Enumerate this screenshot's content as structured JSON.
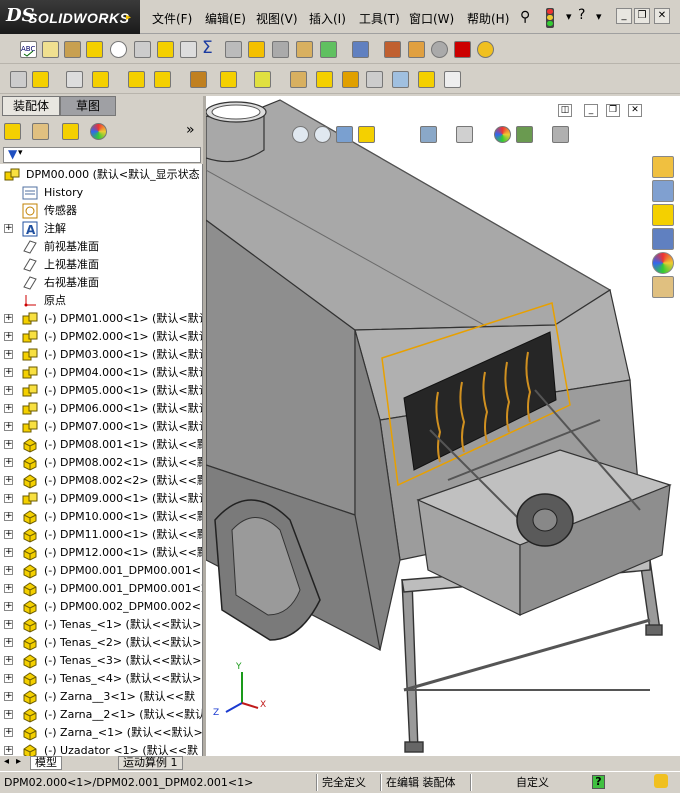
{
  "app": {
    "brand": "SOLIDWORKS",
    "brand_prefix": "DS"
  },
  "menu": [
    "文件(F)",
    "编辑(E)",
    "视图(V)",
    "插入(I)",
    "工具(T)",
    "窗口(W)",
    "帮助(H)"
  ],
  "panel_tabs": {
    "assembly": "装配体",
    "sketch": "草图"
  },
  "tree": {
    "root": "DPM00.000 (默认<默认_显示状态",
    "items": [
      {
        "label": "History",
        "type": "history",
        "expand": false
      },
      {
        "label": "传感器",
        "type": "sensor",
        "expand": false
      },
      {
        "label": "注解",
        "type": "annotation",
        "expand": true
      },
      {
        "label": "前视基准面",
        "type": "plane",
        "expand": false
      },
      {
        "label": "上视基准面",
        "type": "plane",
        "expand": false
      },
      {
        "label": "右视基准面",
        "type": "plane",
        "expand": false
      },
      {
        "label": "原点",
        "type": "origin",
        "expand": false
      },
      {
        "label": "(-) DPM01.000<1> (默认<默认",
        "type": "subasm",
        "expand": true
      },
      {
        "label": "(-) DPM02.000<1> (默认<默认",
        "type": "subasm",
        "expand": true
      },
      {
        "label": "(-) DPM03.000<1> (默认<默认",
        "type": "subasm",
        "expand": true
      },
      {
        "label": "(-) DPM04.000<1> (默认<默认",
        "type": "subasm",
        "expand": true
      },
      {
        "label": "(-) DPM05.000<1> (默认<默认",
        "type": "subasm",
        "expand": true
      },
      {
        "label": "(-) DPM06.000<1> (默认<默认",
        "type": "subasm",
        "expand": true
      },
      {
        "label": "(-) DPM07.000<1> (默认<默认",
        "type": "subasm",
        "expand": true
      },
      {
        "label": "(-) DPM08.001<1> (默认<<默",
        "type": "part",
        "expand": true
      },
      {
        "label": "(-) DPM08.002<1> (默认<<默",
        "type": "part",
        "expand": true
      },
      {
        "label": "(-) DPM08.002<2> (默认<<默",
        "type": "part",
        "expand": true
      },
      {
        "label": "(-) DPM09.000<1> (默认<默认",
        "type": "subasm",
        "expand": true
      },
      {
        "label": "(-) DPM10.000<1> (默认<<默认",
        "type": "part",
        "expand": true
      },
      {
        "label": "(-) DPM11.000<1> (默认<<默认",
        "type": "part",
        "expand": true
      },
      {
        "label": "(-) DPM12.000<1> (默认<<默认",
        "type": "part",
        "expand": true
      },
      {
        "label": "(-) DPM00.001_DPM00.001<1>",
        "type": "part",
        "expand": true
      },
      {
        "label": "(-) DPM00.001_DPM00.001<2>",
        "type": "part",
        "expand": true
      },
      {
        "label": "(-) DPM00.002_DPM00.002<1>",
        "type": "part",
        "expand": true
      },
      {
        "label": "(-) Tenas_<1> (默认<<默认>",
        "type": "part",
        "expand": true
      },
      {
        "label": "(-) Tenas_<2> (默认<<默认>",
        "type": "part",
        "expand": true
      },
      {
        "label": "(-) Tenas_<3> (默认<<默认>",
        "type": "part",
        "expand": true
      },
      {
        "label": "(-) Tenas_<4> (默认<<默认>",
        "type": "part",
        "expand": true
      },
      {
        "label": "(-) Zarna__3<1> (默认<<默",
        "type": "part",
        "expand": true
      },
      {
        "label": "(-) Zarna__2<1> (默认<<默认",
        "type": "part",
        "expand": true
      },
      {
        "label": "(-) Zarna_<1> (默认<<默认>",
        "type": "part",
        "expand": true
      },
      {
        "label": "(-) Uzadator <1> (默认<<默",
        "type": "part",
        "expand": true
      }
    ]
  },
  "bottom_tabs": [
    "模型",
    "运动算例 1"
  ],
  "status": {
    "selection": "DPM02.000<1>/DPM02.001_DPM02.001<1>",
    "constraint": "完全定义",
    "mode": "在编辑 装配体",
    "units": "自定义",
    "help": "?"
  },
  "colors": {
    "accent": "#f1c000",
    "part_yellow": "#f4d000",
    "body_gray": "#8a8a8a",
    "hot_orange": "#e8a000"
  },
  "triad": {
    "x": "X",
    "y": "Y",
    "z": "Z"
  }
}
